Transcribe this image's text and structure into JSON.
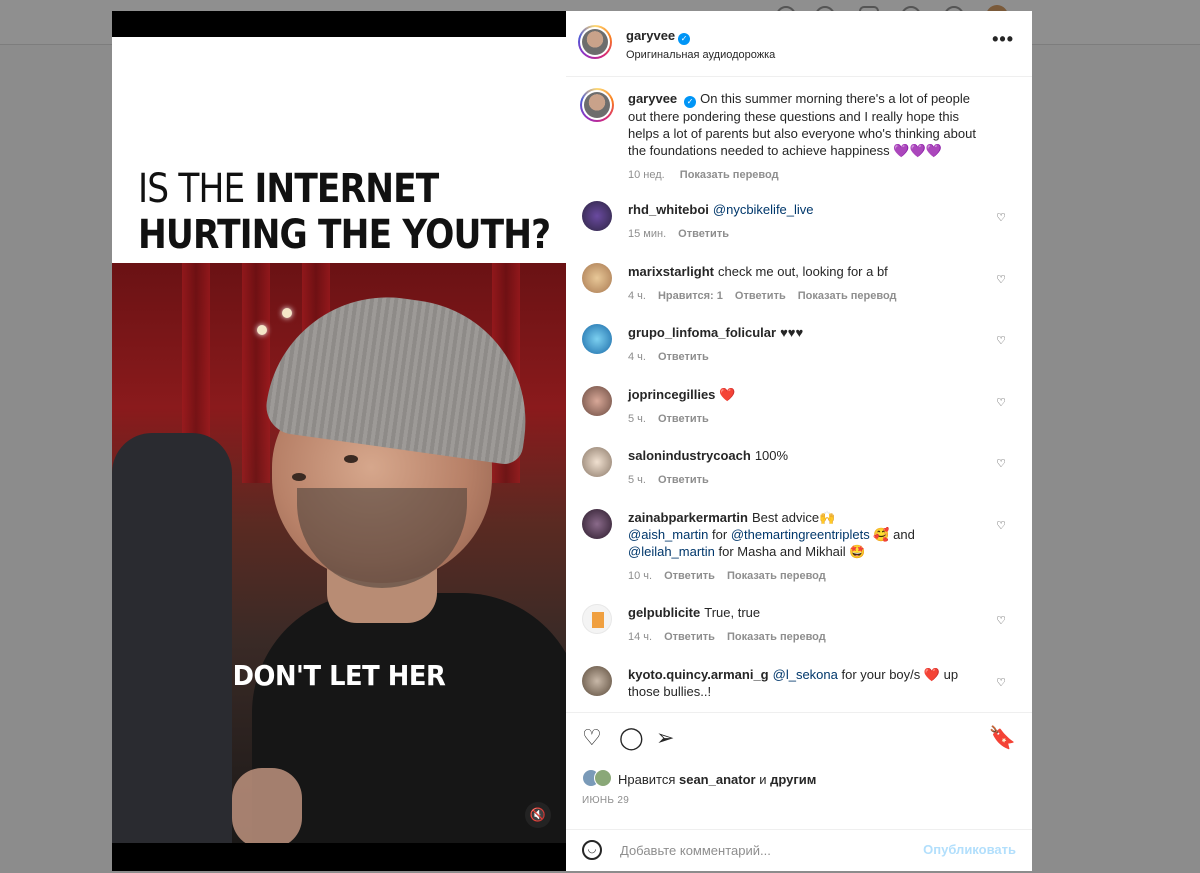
{
  "post": {
    "headline_part1": "IS THE ",
    "headline_bold": "INTERNET",
    "headline_line2": "HURTING THE YOUTH?",
    "video_caption": "DON'T LET HER",
    "mute_icon": "speaker-muted-icon"
  },
  "header": {
    "username": "garyvee",
    "audio": "Оригинальная аудиодорожка",
    "more": "•••"
  },
  "caption": {
    "username": "garyvee",
    "text": "On this summer morning there's a lot of people out there pondering these questions and I really hope this helps a lot of parents but also everyone who's thinking about the foundations needed to achieve happiness 💜💜💜",
    "time": "10 нед.",
    "translate": "Показать перевод"
  },
  "comments": [
    {
      "user": "rhd_whiteboi",
      "pre": "",
      "mention": "@nycbikelife_live",
      "post": "",
      "time": "15 мин.",
      "likes": "",
      "reply": "Ответить",
      "translate": "",
      "avatar": "#2c2440"
    },
    {
      "user": "marixstarlight",
      "pre": "check me out, looking for a bf",
      "mention": "",
      "post": "",
      "time": "4 ч.",
      "likes": "Нравится: 1",
      "reply": "Ответить",
      "translate": "Показать перевод",
      "avatar": "#c8a070"
    },
    {
      "user": "grupo_linfoma_folicular",
      "pre": "♥♥♥",
      "mention": "",
      "post": "",
      "time": "4 ч.",
      "likes": "",
      "reply": "Ответить",
      "translate": "",
      "avatar": "#2a8ec8"
    },
    {
      "user": "joprincegillies",
      "pre": "❤️",
      "mention": "",
      "post": "",
      "time": "5 ч.",
      "likes": "",
      "reply": "Ответить",
      "translate": "",
      "avatar": "#b07a6a"
    },
    {
      "user": "salonindustrycoach",
      "pre": "100%",
      "mention": "",
      "post": "",
      "time": "5 ч.",
      "likes": "",
      "reply": "Ответить",
      "translate": "",
      "avatar": "#d8c0a8"
    },
    {
      "user": "zainabparkermartin",
      "pre": "Best advice🙌",
      "mention": "",
      "post": "",
      "time": "10 ч.",
      "likes": "",
      "reply": "Ответить",
      "translate": "Показать перевод",
      "avatar": "#4a3a5a"
    },
    {
      "user": "gelpublicite",
      "pre": "True, true",
      "mention": "",
      "post": "",
      "time": "14 ч.",
      "likes": "",
      "reply": "Ответить",
      "translate": "Показать перевод",
      "avatar": "#f0a040"
    },
    {
      "user": "kyoto.quincy.armani_g",
      "pre": "",
      "mention": "@l_sekona",
      "post": "for your boy/s ❤️ up those bullies..!",
      "time": "",
      "likes": "",
      "reply": "",
      "translate": "",
      "avatar": "#9a8a7a"
    }
  ],
  "zainab_extra": {
    "m1": "@aish_martin",
    "t1": " for ",
    "m2": "@themartingreentriplets",
    "t2": " 🥰 and ",
    "m3": "@leilah_martin",
    "t3": " for Masha and Mikhail 🤩"
  },
  "actions": {
    "like_icon": "heart-outline-icon",
    "comment_icon": "comment-bubble-icon",
    "share_icon": "paper-plane-icon",
    "save_icon": "bookmark-icon"
  },
  "likes": {
    "prefix": "Нравится ",
    "user": "sean_anator",
    "middle": " и ",
    "others": "другим"
  },
  "date": "ИЮНЬ 29",
  "composer": {
    "placeholder": "Добавьте комментарий...",
    "publish": "Опубликовать"
  }
}
